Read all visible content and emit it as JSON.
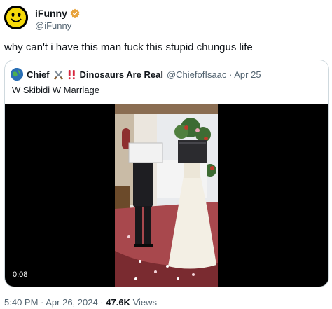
{
  "author": {
    "display_name": "iFunny",
    "handle": "@iFunny",
    "avatar_icon": "smiley-face-icon",
    "verified_icon": "verified-badge-icon"
  },
  "tweet": {
    "text": "why can't i have this man fuck this stupid chungus life"
  },
  "quoted": {
    "name": "Chief",
    "name_suffix": "Dinosaurs Are Real",
    "handle_date": "@ChiefofIsaac · Apr 25",
    "text": "W Skibidi W Marriage",
    "emoji_icons": [
      "crossed-swords-icon",
      "double-exclamation-icon"
    ]
  },
  "video": {
    "duration": "0:08"
  },
  "footer": {
    "time_date": "5:40 PM · Apr 26, 2024 · ",
    "views_count": "47.6K",
    "views_label": " Views"
  },
  "colors": {
    "text_primary": "#0f1419",
    "text_secondary": "#536471",
    "border": "#cfd9de",
    "verified_gold": "#e8a33c"
  }
}
